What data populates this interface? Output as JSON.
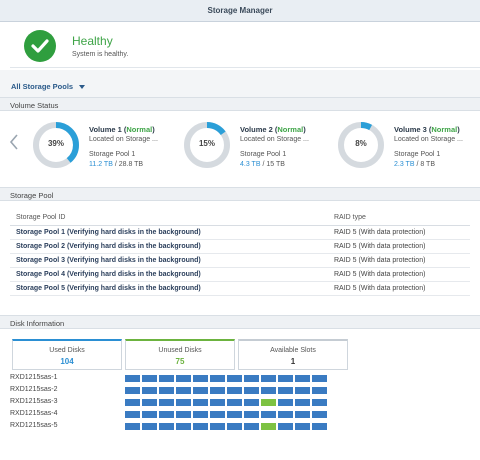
{
  "window": {
    "title": "Storage Manager"
  },
  "health": {
    "status": "Healthy",
    "message": "System is healthy."
  },
  "filter": {
    "label": "All Storage Pools"
  },
  "volume_status": {
    "header": "Volume Status",
    "volumes": [
      {
        "percent": "39%",
        "fraction": 0.39,
        "name": "Volume 1",
        "state": "Normal",
        "location": "Located on Storage ...",
        "pool": "Storage Pool 1",
        "used": "11.2 TB",
        "total": "/ 28.8 TB"
      },
      {
        "percent": "15%",
        "fraction": 0.15,
        "name": "Volume 2",
        "state": "Normal",
        "location": "Located on Storage ...",
        "pool": "Storage Pool 1",
        "used": "4.3 TB",
        "total": "/ 15 TB"
      },
      {
        "percent": "8%",
        "fraction": 0.08,
        "name": "Volume 3",
        "state": "Normal",
        "location": "Located on Storage ...",
        "pool": "Storage Pool 1",
        "used": "2.3 TB",
        "total": "/ 8 TB"
      }
    ]
  },
  "storage_pool": {
    "header": "Storage Pool",
    "columns": {
      "id": "Storage Pool ID",
      "raid": "RAID type"
    },
    "rows": [
      {
        "id": "Storage Pool 1 (Verifying hard disks in the background)",
        "raid": "RAID 5 (With data protection)"
      },
      {
        "id": "Storage Pool 2 (Verifying hard disks in the background)",
        "raid": "RAID 5 (With data protection)"
      },
      {
        "id": "Storage Pool 3 (Verifying hard disks in the background)",
        "raid": "RAID 5 (With data protection)"
      },
      {
        "id": "Storage Pool 4 (Verifying hard disks in the background)",
        "raid": "RAID 5 (With data protection)"
      },
      {
        "id": "Storage Pool 5 (Verifying hard disks in the background)",
        "raid": "RAID 5 (With data protection)"
      }
    ]
  },
  "disk_info": {
    "header": "Disk Information",
    "used": {
      "label": "Used Disks",
      "value": "104",
      "color": "#2b8fd3"
    },
    "unused": {
      "label": "Unused Disks",
      "value": "75",
      "color": "#6cb33f"
    },
    "available": {
      "label": "Available Slots",
      "value": "1",
      "color": "#333333"
    },
    "enclosures": [
      {
        "name": "RXD1215sas-1",
        "slots": [
          "used",
          "used",
          "used",
          "used",
          "used",
          "used",
          "used",
          "used",
          "used",
          "used",
          "used",
          "used"
        ]
      },
      {
        "name": "RXD1215sas-2",
        "slots": [
          "used",
          "used",
          "used",
          "used",
          "used",
          "used",
          "used",
          "used",
          "used",
          "used",
          "used",
          "used"
        ]
      },
      {
        "name": "RXD1215sas-3",
        "slots": [
          "used",
          "used",
          "used",
          "used",
          "used",
          "used",
          "used",
          "used",
          "unused",
          "used",
          "used",
          "used"
        ]
      },
      {
        "name": "RXD1215sas-4",
        "slots": [
          "used",
          "used",
          "used",
          "used",
          "used",
          "used",
          "used",
          "used",
          "used",
          "used",
          "used",
          "used"
        ]
      },
      {
        "name": "RXD1215sas-5",
        "slots": [
          "used",
          "used",
          "used",
          "used",
          "used",
          "used",
          "used",
          "used",
          "unused",
          "used",
          "used",
          "used"
        ]
      }
    ]
  },
  "colors": {
    "ring_fill": "#2b9fd8",
    "ring_track": "#d5dadf",
    "used_slot": "#3a7bc2",
    "unused_slot": "#7dc242",
    "healthy": "#2f9e3e"
  }
}
